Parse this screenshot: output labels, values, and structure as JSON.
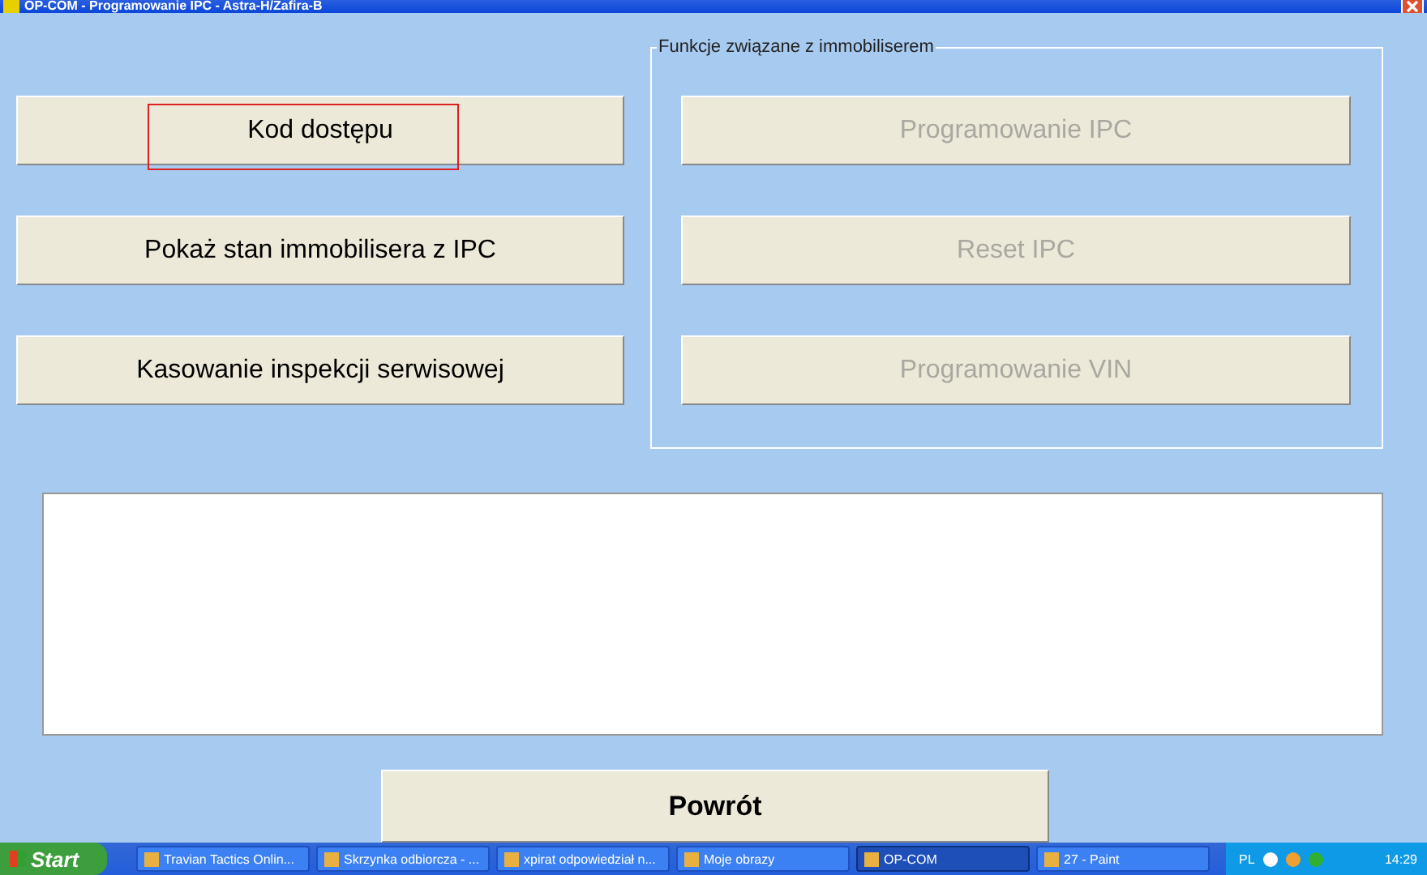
{
  "window": {
    "title": "OP-COM - Programowanie IPC - Astra-H/Zafira-B"
  },
  "left_buttons": [
    {
      "label": "Kod dostępu",
      "disabled": false,
      "highlighted": true
    },
    {
      "label": "Pokaż stan immobilisera z IPC",
      "disabled": false,
      "highlighted": false
    },
    {
      "label": "Kasowanie inspekcji serwisowej",
      "disabled": false,
      "highlighted": false
    }
  ],
  "group": {
    "legend": "Funkcje związane z immobiliserem",
    "buttons": [
      {
        "label": "Programowanie IPC",
        "disabled": true
      },
      {
        "label": "Reset IPC",
        "disabled": true
      },
      {
        "label": "Programowanie VIN",
        "disabled": true
      }
    ]
  },
  "back_button": {
    "label": "Powrót"
  },
  "taskbar": {
    "start": "Start",
    "tasks": [
      {
        "label": "Travian Tactics Onlin...",
        "selected": false
      },
      {
        "label": "Skrzynka odbiorcza - ...",
        "selected": false
      },
      {
        "label": "xpirat odpowiedział n...",
        "selected": false
      },
      {
        "label": "Moje obrazy",
        "selected": false
      },
      {
        "label": "OP-COM",
        "selected": true
      },
      {
        "label": "27 - Paint",
        "selected": false
      }
    ],
    "language": "PL",
    "time": "14:29"
  }
}
